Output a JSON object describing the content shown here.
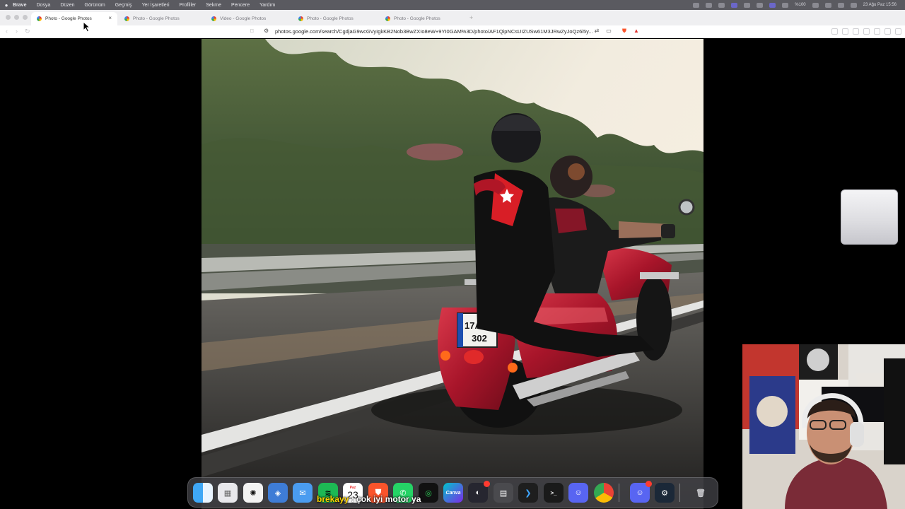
{
  "menubar": {
    "apple_icon": "apple-logo-icon",
    "app_name": "Brave",
    "items": [
      "Dosya",
      "Düzen",
      "Görünüm",
      "Geçmiş",
      "Yer İşaretleri",
      "Profiller",
      "Sekme",
      "Pencere",
      "Yardım"
    ],
    "status_text": "%100",
    "datetime": "23 Ağu Paz 15:56"
  },
  "tabs": [
    {
      "title": "Photo - Google Photos",
      "active": true,
      "close": "×"
    },
    {
      "title": "Photo - Google Photos",
      "active": false
    },
    {
      "title": "Video - Google Photos",
      "active": false
    },
    {
      "title": "Photo - Google Photos",
      "active": false
    },
    {
      "title": "Photo - Google Photos",
      "active": false
    }
  ],
  "new_tab": "+",
  "toolbar": {
    "back": "‹",
    "forward": "›",
    "reload": "↻",
    "url": "photos.google.com/search/CgdjaG9wcGVyIgkKB2Nob3BwZXIo8eW+9YI0GAM%3D/photo/AF1QipNCsUIZUSw61M3JRwZyJoQz6i5y..."
  },
  "photo": {
    "subject": "motorcycle-riders-photo",
    "plate_line1": "17AAE",
    "plate_line2": "302"
  },
  "subtitle": {
    "highlight": "brekayy",
    "text": " : çok iyi motor ya"
  },
  "dock": {
    "calendar_month": "Paz",
    "calendar_day": "23",
    "canva_label": "Canva",
    "terminal_label": ">_",
    "apps": [
      "finder",
      "launchpad",
      "chatgpt",
      "safari-like",
      "mail",
      "spotify",
      "calendar",
      "brave",
      "whatsapp",
      "activity",
      "canva",
      "obs",
      "calculator",
      "vscode",
      "terminal",
      "discord",
      "chrome",
      "discord-2",
      "steam",
      "trash"
    ]
  },
  "colors": {
    "menubar": "#5a5a60",
    "tabstrip": "#efeff1",
    "accent_purple": "#6b67c9",
    "motorcycle_red": "#b0182a",
    "subtitle_highlight": "#ffd400"
  }
}
